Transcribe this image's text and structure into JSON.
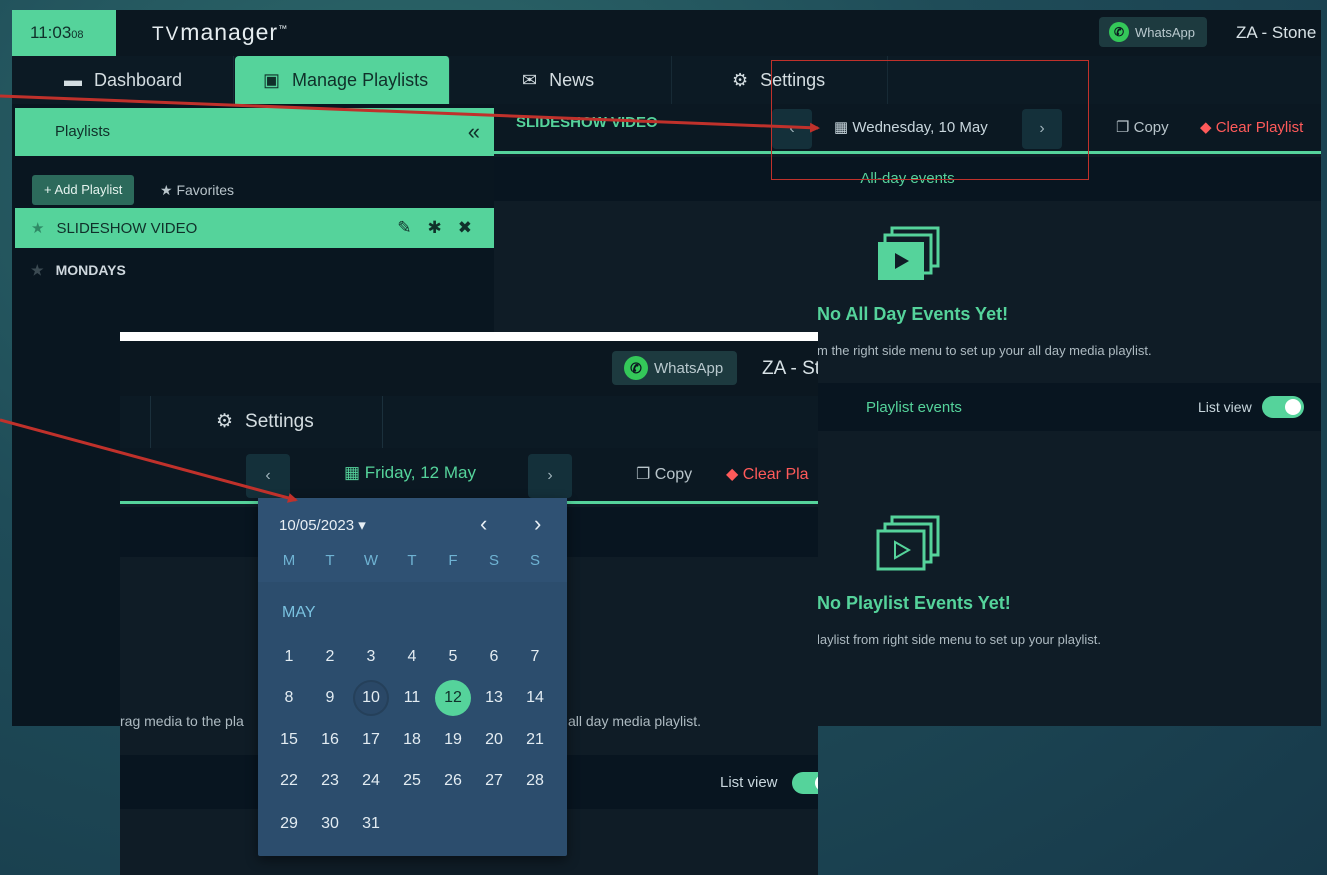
{
  "app": {
    "clock": {
      "time": "11:03",
      "seconds": "08"
    },
    "logo": {
      "tv": "TV",
      "name": "manager",
      "mark": "™"
    },
    "whatsapp_label": "WhatsApp",
    "account": "ZA - Stone",
    "nav": {
      "dashboard": "Dashboard",
      "manage_playlists": "Manage Playlists",
      "news": "News",
      "settings": "Settings"
    },
    "sidebar": {
      "title": "Playlists",
      "collapse": "«",
      "add_playlist": "+ Add Playlist",
      "favorites": "Favorites",
      "playlists": [
        "SLIDESHOW VIDEO",
        "MONDAYS"
      ]
    },
    "main": {
      "playlist_title": "SLIDESHOW VIDEO",
      "date": "Wednesday, 10 May",
      "copy": "Copy",
      "clear": "Clear Playlist",
      "allday_label": "All-day events",
      "allday_empty_title": "No All Day Events Yet!",
      "allday_empty_sub": "m the right side menu to set up your all day media playlist.",
      "playlist_events_label": "Playlist events",
      "list_view": "List view",
      "pe_empty_title": "No Playlist Events Yet!",
      "pe_empty_sub": "laylist from right side menu to set up your playlist."
    }
  },
  "inset": {
    "whatsapp_label": "WhatsApp",
    "account": "ZA - St",
    "settings": "Settings",
    "left_fragment": ")",
    "date": "Friday, 12 May",
    "copy": "Copy",
    "clear": "Clear Pla",
    "text_left": "rag media to the pla",
    "text_right": "all day media playlist.",
    "list_view": "List view"
  },
  "datepicker": {
    "month_select": "10/05/2023",
    "weekdays": [
      "M",
      "T",
      "W",
      "T",
      "F",
      "S",
      "S"
    ],
    "month_name": "MAY",
    "weeks": [
      [
        "1",
        "2",
        "3",
        "4",
        "5",
        "6",
        "7"
      ],
      [
        "8",
        "9",
        "10",
        "11",
        "12",
        "13",
        "14"
      ],
      [
        "15",
        "16",
        "17",
        "18",
        "19",
        "20",
        "21"
      ],
      [
        "22",
        "23",
        "24",
        "25",
        "26",
        "27",
        "28"
      ],
      [
        "29",
        "30",
        "31"
      ]
    ],
    "today": "10",
    "selected": "12"
  },
  "colors": {
    "accent": "#55d39b",
    "danger": "#ff5a5a",
    "annotation": "#c0312b",
    "picker_bg": "#2c4d6d"
  }
}
